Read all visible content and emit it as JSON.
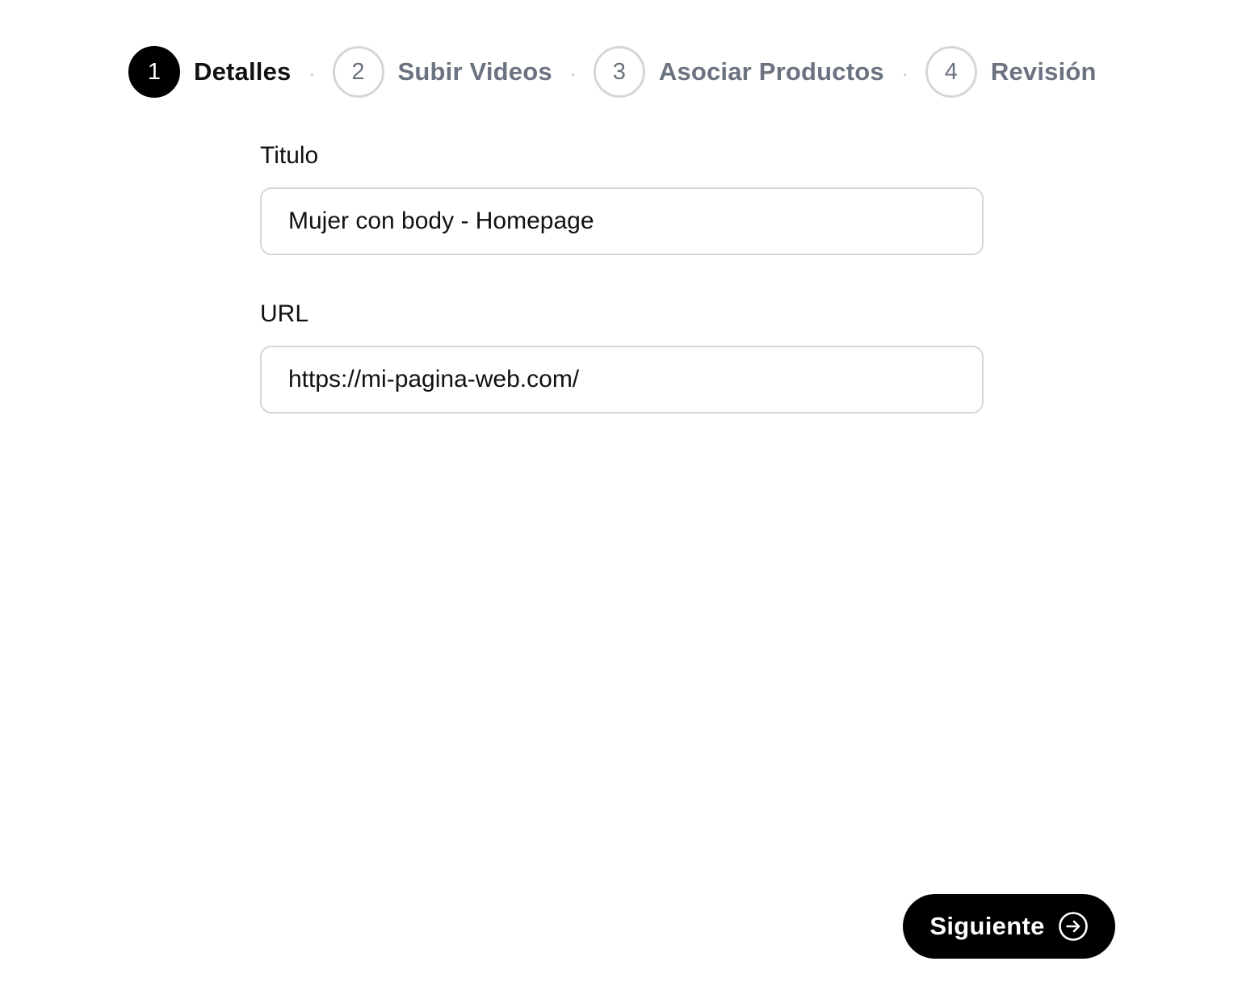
{
  "stepper": {
    "steps": [
      {
        "number": "1",
        "label": "Detalles",
        "state": "active"
      },
      {
        "number": "2",
        "label": "Subir Videos",
        "state": "pending"
      },
      {
        "number": "3",
        "label": "Asociar Productos",
        "state": "pending"
      },
      {
        "number": "4",
        "label": "Revisión",
        "state": "pending"
      }
    ]
  },
  "form": {
    "title": {
      "label": "Titulo",
      "value": "Mujer con body - Homepage"
    },
    "url": {
      "label": "URL",
      "value": "https://mi-pagina-web.com/"
    }
  },
  "actions": {
    "next_label": "Siguiente",
    "next_icon": "arrow-right-circle-icon"
  },
  "colors": {
    "active_step": "#000000",
    "pending_step_text": "#6b7280",
    "border": "#d4d6da",
    "primary_button": "#000000"
  }
}
